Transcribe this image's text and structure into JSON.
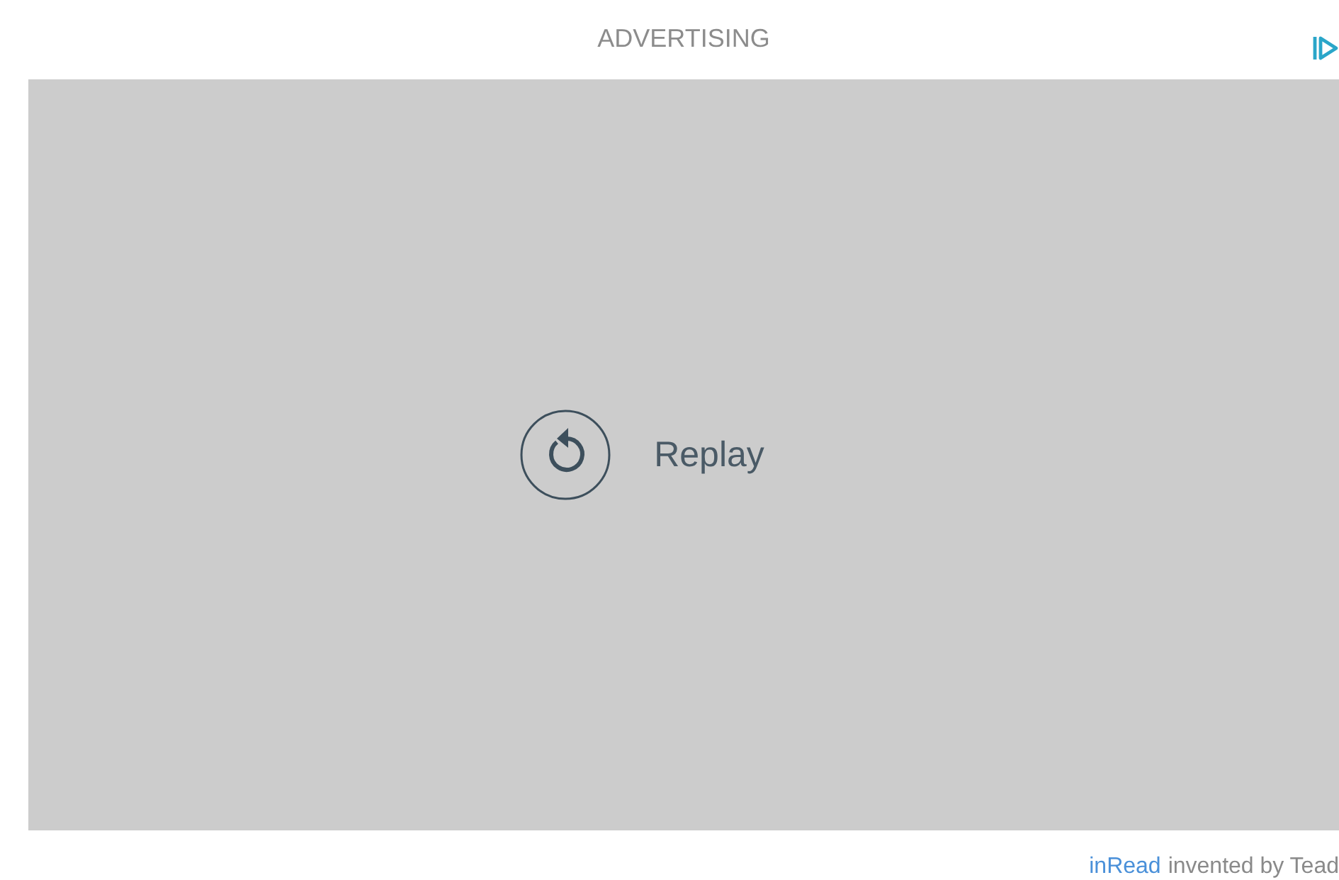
{
  "header": {
    "label": "ADVERTISING"
  },
  "player": {
    "replay_label": "Replay"
  },
  "footer": {
    "link": "inRead",
    "text": "invented by Tead"
  }
}
